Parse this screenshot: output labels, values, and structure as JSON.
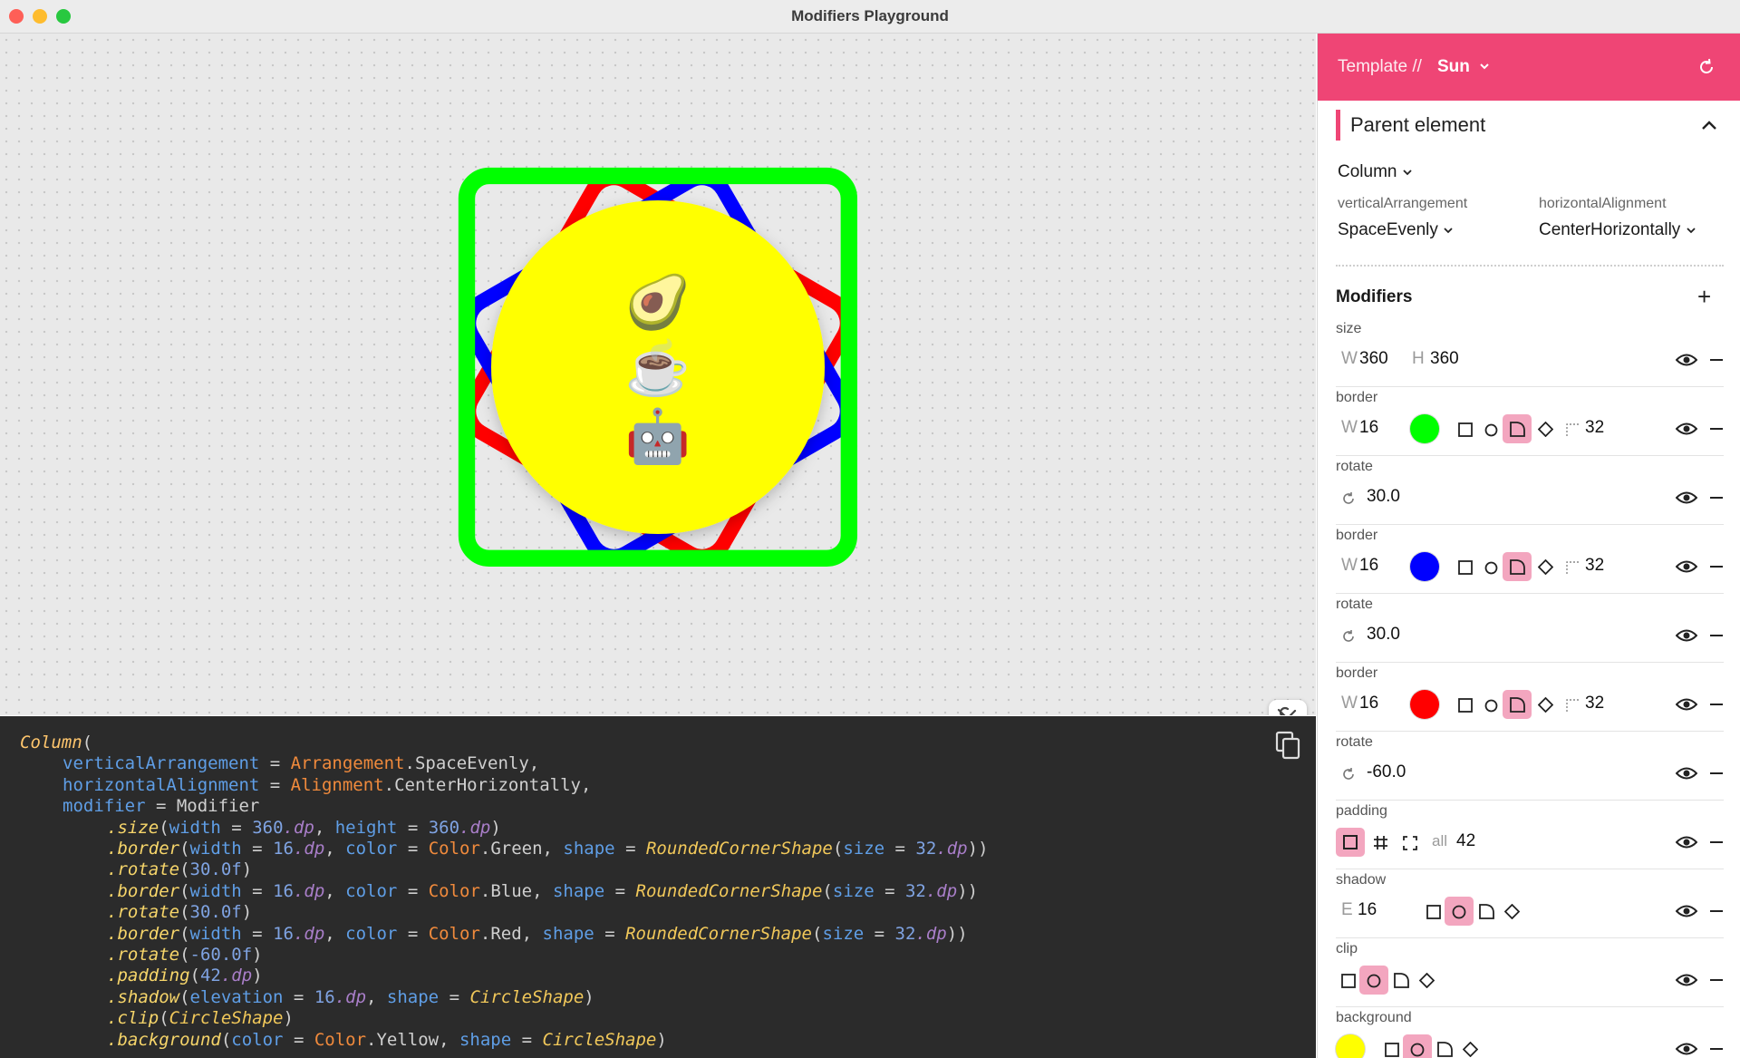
{
  "window": {
    "title": "Modifiers Playground"
  },
  "preview": {
    "emojis": [
      "🥑",
      "☕",
      "🤖"
    ]
  },
  "code": {
    "lines": [
      [
        {
          "t": "Column",
          "c": "fn"
        },
        {
          "t": "(",
          "c": ""
        }
      ],
      [
        {
          "t": "verticalArrangement",
          "c": "pa"
        },
        {
          "t": " = ",
          "c": ""
        },
        {
          "t": "Arrangement",
          "c": "cl"
        },
        {
          "t": ".SpaceEvenly,",
          "c": ""
        }
      ],
      [
        {
          "t": "horizontalAlignment",
          "c": "pa"
        },
        {
          "t": " = ",
          "c": ""
        },
        {
          "t": "Alignment",
          "c": "cl"
        },
        {
          "t": ".CenterHorizontally,",
          "c": ""
        }
      ],
      [
        {
          "t": "modifier",
          "c": "pa"
        },
        {
          "t": " = Modifier",
          "c": ""
        }
      ],
      [
        {
          "t": ".size",
          "c": "fi"
        },
        {
          "t": "(",
          "c": ""
        },
        {
          "t": "width",
          "c": "pa"
        },
        {
          "t": " = ",
          "c": ""
        },
        {
          "t": "360",
          "c": "nm"
        },
        {
          "t": ".dp",
          "c": "un"
        },
        {
          "t": ", ",
          "c": ""
        },
        {
          "t": "height",
          "c": "pa"
        },
        {
          "t": " = ",
          "c": ""
        },
        {
          "t": "360",
          "c": "nm"
        },
        {
          "t": ".dp",
          "c": "un"
        },
        {
          "t": ")",
          "c": ""
        }
      ],
      [
        {
          "t": ".border",
          "c": "fi"
        },
        {
          "t": "(",
          "c": ""
        },
        {
          "t": "width",
          "c": "pa"
        },
        {
          "t": " = ",
          "c": ""
        },
        {
          "t": "16",
          "c": "nm"
        },
        {
          "t": ".dp",
          "c": "un"
        },
        {
          "t": ", ",
          "c": ""
        },
        {
          "t": "color",
          "c": "pa"
        },
        {
          "t": " = ",
          "c": ""
        },
        {
          "t": "Color",
          "c": "cl"
        },
        {
          "t": ".Green, ",
          "c": ""
        },
        {
          "t": "shape",
          "c": "pa"
        },
        {
          "t": " = ",
          "c": ""
        },
        {
          "t": "RoundedCornerShape",
          "c": "sh"
        },
        {
          "t": "(",
          "c": ""
        },
        {
          "t": "size",
          "c": "pa"
        },
        {
          "t": " = ",
          "c": ""
        },
        {
          "t": "32",
          "c": "nm"
        },
        {
          "t": ".dp",
          "c": "un"
        },
        {
          "t": "))",
          "c": ""
        }
      ],
      [
        {
          "t": ".rotate",
          "c": "fi"
        },
        {
          "t": "(",
          "c": ""
        },
        {
          "t": "30.0f",
          "c": "nm"
        },
        {
          "t": ")",
          "c": ""
        }
      ],
      [
        {
          "t": ".border",
          "c": "fi"
        },
        {
          "t": "(",
          "c": ""
        },
        {
          "t": "width",
          "c": "pa"
        },
        {
          "t": " = ",
          "c": ""
        },
        {
          "t": "16",
          "c": "nm"
        },
        {
          "t": ".dp",
          "c": "un"
        },
        {
          "t": ", ",
          "c": ""
        },
        {
          "t": "color",
          "c": "pa"
        },
        {
          "t": " = ",
          "c": ""
        },
        {
          "t": "Color",
          "c": "cl"
        },
        {
          "t": ".Blue, ",
          "c": ""
        },
        {
          "t": "shape",
          "c": "pa"
        },
        {
          "t": " = ",
          "c": ""
        },
        {
          "t": "RoundedCornerShape",
          "c": "sh"
        },
        {
          "t": "(",
          "c": ""
        },
        {
          "t": "size",
          "c": "pa"
        },
        {
          "t": " = ",
          "c": ""
        },
        {
          "t": "32",
          "c": "nm"
        },
        {
          "t": ".dp",
          "c": "un"
        },
        {
          "t": "))",
          "c": ""
        }
      ],
      [
        {
          "t": ".rotate",
          "c": "fi"
        },
        {
          "t": "(",
          "c": ""
        },
        {
          "t": "30.0f",
          "c": "nm"
        },
        {
          "t": ")",
          "c": ""
        }
      ],
      [
        {
          "t": ".border",
          "c": "fi"
        },
        {
          "t": "(",
          "c": ""
        },
        {
          "t": "width",
          "c": "pa"
        },
        {
          "t": " = ",
          "c": ""
        },
        {
          "t": "16",
          "c": "nm"
        },
        {
          "t": ".dp",
          "c": "un"
        },
        {
          "t": ", ",
          "c": ""
        },
        {
          "t": "color",
          "c": "pa"
        },
        {
          "t": " = ",
          "c": ""
        },
        {
          "t": "Color",
          "c": "cl"
        },
        {
          "t": ".Red, ",
          "c": ""
        },
        {
          "t": "shape",
          "c": "pa"
        },
        {
          "t": " = ",
          "c": ""
        },
        {
          "t": "RoundedCornerShape",
          "c": "sh"
        },
        {
          "t": "(",
          "c": ""
        },
        {
          "t": "size",
          "c": "pa"
        },
        {
          "t": " = ",
          "c": ""
        },
        {
          "t": "32",
          "c": "nm"
        },
        {
          "t": ".dp",
          "c": "un"
        },
        {
          "t": "))",
          "c": ""
        }
      ],
      [
        {
          "t": ".rotate",
          "c": "fi"
        },
        {
          "t": "(",
          "c": ""
        },
        {
          "t": "-60.0f",
          "c": "nm"
        },
        {
          "t": ")",
          "c": ""
        }
      ],
      [
        {
          "t": ".padding",
          "c": "fi"
        },
        {
          "t": "(",
          "c": ""
        },
        {
          "t": "42",
          "c": "nm"
        },
        {
          "t": ".dp",
          "c": "un"
        },
        {
          "t": ")",
          "c": ""
        }
      ],
      [
        {
          "t": ".shadow",
          "c": "fi"
        },
        {
          "t": "(",
          "c": ""
        },
        {
          "t": "elevation",
          "c": "pa"
        },
        {
          "t": " = ",
          "c": ""
        },
        {
          "t": "16",
          "c": "nm"
        },
        {
          "t": ".dp",
          "c": "un"
        },
        {
          "t": ", ",
          "c": ""
        },
        {
          "t": "shape",
          "c": "pa"
        },
        {
          "t": " = ",
          "c": ""
        },
        {
          "t": "CircleShape",
          "c": "sh"
        },
        {
          "t": ")",
          "c": ""
        }
      ],
      [
        {
          "t": ".clip",
          "c": "fi"
        },
        {
          "t": "(",
          "c": ""
        },
        {
          "t": "CircleShape",
          "c": "sh"
        },
        {
          "t": ")",
          "c": ""
        }
      ],
      [
        {
          "t": ".background",
          "c": "fi"
        },
        {
          "t": "(",
          "c": ""
        },
        {
          "t": "color",
          "c": "pa"
        },
        {
          "t": " = ",
          "c": ""
        },
        {
          "t": "Color",
          "c": "cl"
        },
        {
          "t": ".Yellow, ",
          "c": ""
        },
        {
          "t": "shape",
          "c": "pa"
        },
        {
          "t": " = ",
          "c": ""
        },
        {
          "t": "CircleShape",
          "c": "sh"
        },
        {
          "t": ")",
          "c": ""
        }
      ]
    ]
  },
  "panel": {
    "template_label": "Template //",
    "template_value": "Sun",
    "parent_title": "Parent element",
    "layout_type": "Column",
    "vertical_label": "verticalArrangement",
    "vertical_value": "SpaceEvenly",
    "horizontal_label": "horizontalAlignment",
    "horizontal_value": "CenterHorizontally",
    "modifiers_title": "Modifiers",
    "size": {
      "name": "size",
      "w_label": "W",
      "w": "360",
      "h_label": "H",
      "h": "360"
    },
    "border1": {
      "name": "border",
      "w_label": "W",
      "w": "16",
      "color": "#00ff00",
      "corner": "32"
    },
    "rotate1": {
      "name": "rotate",
      "value": "30.0"
    },
    "border2": {
      "name": "border",
      "w_label": "W",
      "w": "16",
      "color": "#0000ff",
      "corner": "32"
    },
    "rotate2": {
      "name": "rotate",
      "value": "30.0"
    },
    "border3": {
      "name": "border",
      "w_label": "W",
      "w": "16",
      "color": "#ff0000",
      "corner": "32"
    },
    "rotate3": {
      "name": "rotate",
      "value": "-60.0"
    },
    "padding": {
      "name": "padding",
      "all_label": "all",
      "all": "42"
    },
    "shadow": {
      "name": "shadow",
      "e_label": "E",
      "e": "16"
    },
    "clip": {
      "name": "clip"
    },
    "background": {
      "name": "background",
      "color": "#ffff00"
    }
  },
  "colors": {
    "accent": "#ef4575",
    "selected_bg": "#f3a6bf",
    "code_bg": "#2b2b2b"
  }
}
